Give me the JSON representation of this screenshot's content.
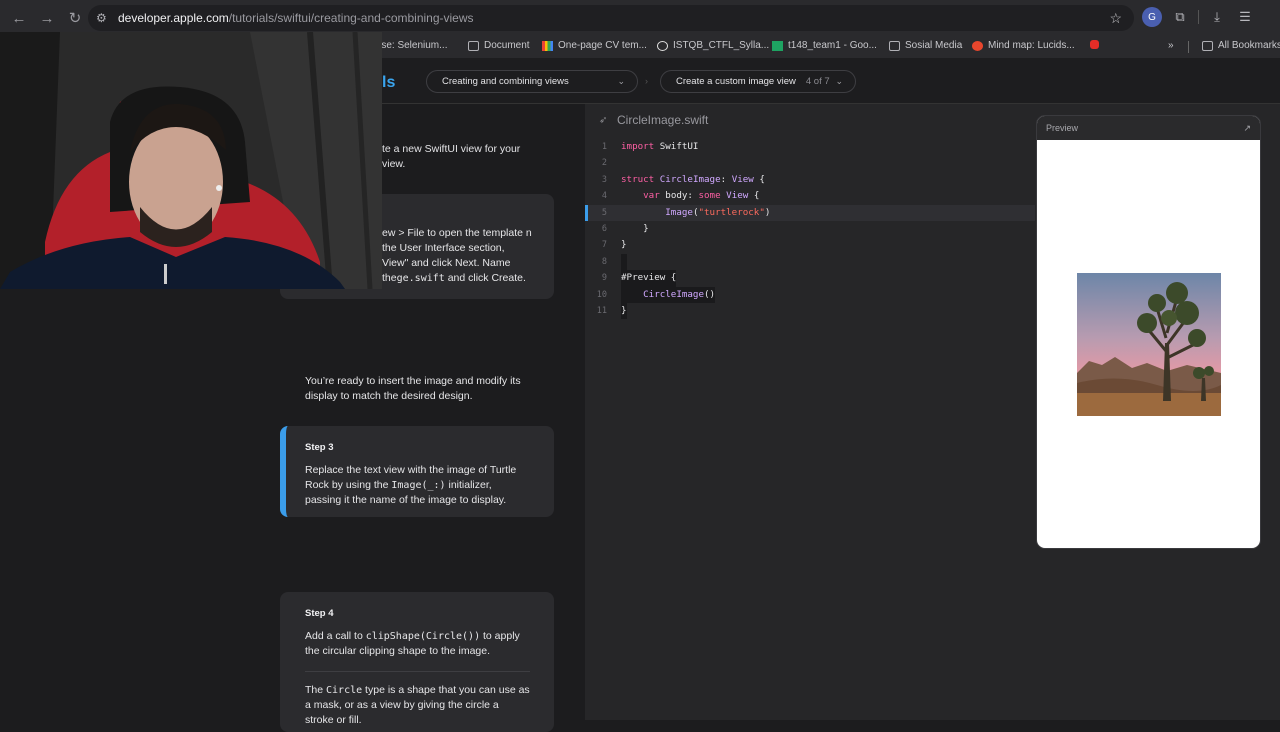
{
  "browser": {
    "url_domain": "developer.apple.com",
    "url_path": "/tutorials/swiftui/creating-and-combining-views",
    "bookmarks": [
      {
        "label": "rse: Selenium...",
        "icon": "google-favicon-icon"
      },
      {
        "label": "Document",
        "icon": "folder-icon"
      },
      {
        "label": "One-page CV tem...",
        "icon": "google-favicon-icon"
      },
      {
        "label": "ISTQB_CTFL_Sylla...",
        "icon": "globe-icon"
      },
      {
        "label": "t148_team1 - Goo...",
        "icon": "sheets-icon"
      },
      {
        "label": "Sosial Media",
        "icon": "folder-icon"
      },
      {
        "label": "Mind map: Lucids...",
        "icon": "lucid-icon"
      },
      {
        "label": "",
        "icon": "youtube-icon"
      }
    ],
    "more_bookmarks": "»",
    "all_bookmarks": "All Bookmarks"
  },
  "subnav": {
    "brand_fragment": "ls",
    "tutorial_select": "Creating and combining views",
    "section_select": "Create a custom image view",
    "section_counter": "4 of 7"
  },
  "steps": {
    "intro": "te a new SwiftUI view for your view.",
    "card_a": "ew > File to open the template n the User Interface section, View\" and click Next. Name the",
    "card_a_mono": "ge.swift",
    "card_a_tail": " and click Create.",
    "ready": "You’re ready to insert the image and modify its display to match the desired design.",
    "step3_title": "Step 3",
    "step3_pre": "Replace the text view with the image of Turtle Rock by using the ",
    "step3_mono": "Image(_:)",
    "step3_post": " initializer, passing it the name of the image to display.",
    "step4_title": "Step 4",
    "step4_pre": "Add a call to ",
    "step4_mono": "clipShape(Circle())",
    "step4_post": " to apply the circular clipping shape to the image.",
    "step4b_pre": "The ",
    "step4b_mono": "Circle",
    "step4b_post": " type is a shape that you can use as a mask, or as a view by giving the circle a stroke or fill."
  },
  "editor": {
    "filename": "CircleImage.swift",
    "lines": [
      {
        "n": "1",
        "t": "import SwiftUI"
      },
      {
        "n": "2",
        "t": ""
      },
      {
        "n": "3",
        "t": "struct CircleImage: View {"
      },
      {
        "n": "4",
        "t": "    var body: some View {"
      },
      {
        "n": "5",
        "t": "        Image(\"turtlerock\")"
      },
      {
        "n": "6",
        "t": "    }"
      },
      {
        "n": "7",
        "t": "}"
      },
      {
        "n": "8",
        "t": ""
      },
      {
        "n": "9",
        "t": "#Preview {"
      },
      {
        "n": "10",
        "t": "    CircleImage()"
      },
      {
        "n": "11",
        "t": "}"
      }
    ]
  },
  "preview": {
    "title": "Preview",
    "expand_icon": "↗"
  },
  "colors": {
    "accent": "#3b9dea",
    "keyword": "#fc5fa3",
    "type": "#d0a8ff",
    "string": "#fc6a5d"
  }
}
